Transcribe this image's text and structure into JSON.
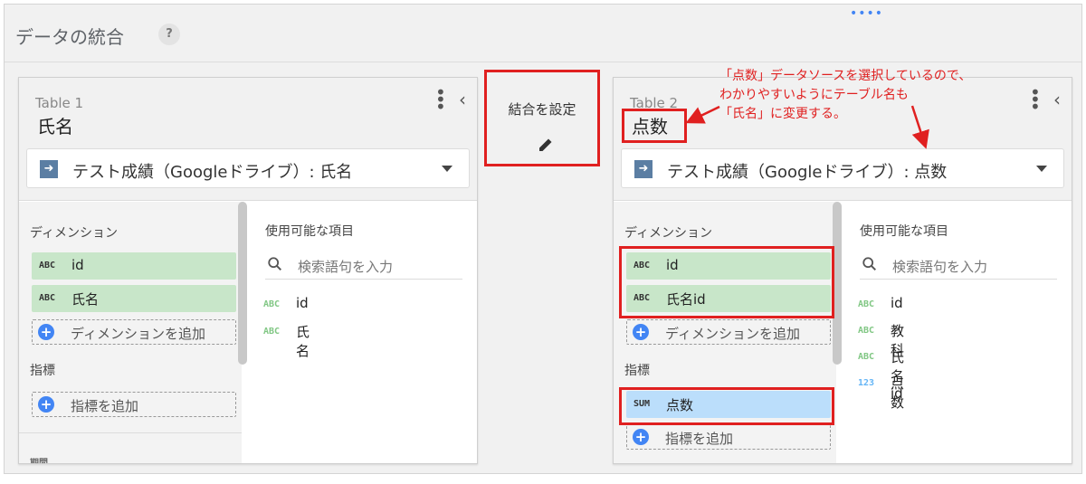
{
  "header": {
    "title": "データの統合",
    "help": "?"
  },
  "join": {
    "label": "結合を設定",
    "icon": "pencil-icon"
  },
  "table1": {
    "label": "Table 1",
    "name": "氏名",
    "datasource": "テスト成績（Googleドライブ）: 氏名",
    "dimensions_title": "ディメンション",
    "dimensions": [
      {
        "type": "ABC",
        "name": "id"
      },
      {
        "type": "ABC",
        "name": "氏名"
      }
    ],
    "add_dimension": "ディメンションを追加",
    "metrics_title": "指標",
    "add_metric": "指標を追加",
    "next_section": "期間",
    "available_title": "使用可能な項目",
    "search_placeholder": "検索語句を入力",
    "available": [
      {
        "type": "ABC",
        "name": "id"
      },
      {
        "type": "ABC",
        "name": "氏名"
      }
    ]
  },
  "table2": {
    "label": "Table 2",
    "name": "点数",
    "datasource": "テスト成績（Googleドライブ）: 点数",
    "dimensions_title": "ディメンション",
    "dimensions": [
      {
        "type": "ABC",
        "name": "id"
      },
      {
        "type": "ABC",
        "name": "氏名id"
      }
    ],
    "add_dimension": "ディメンションを追加",
    "metrics_title": "指標",
    "metrics": [
      {
        "type": "SUM",
        "name": "点数"
      }
    ],
    "add_metric": "指標を追加",
    "available_title": "使用可能な項目",
    "search_placeholder": "検索語句を入力",
    "available": [
      {
        "type": "ABC",
        "name": "id"
      },
      {
        "type": "ABC",
        "name": "教科"
      },
      {
        "type": "ABC",
        "name": "氏名id"
      },
      {
        "type": "123",
        "name": "点数"
      }
    ]
  },
  "annotation": {
    "lines": [
      "「点数」データソースを選択しているので、",
      "わかりやすいようにテーブル名も",
      "「氏名」に変更する。"
    ],
    "color": "#e02020"
  },
  "colors": {
    "dimension_chip": "#c8e6c9",
    "metric_chip": "#bbdefb",
    "accent": "#4285f4",
    "highlight": "#e02020"
  }
}
